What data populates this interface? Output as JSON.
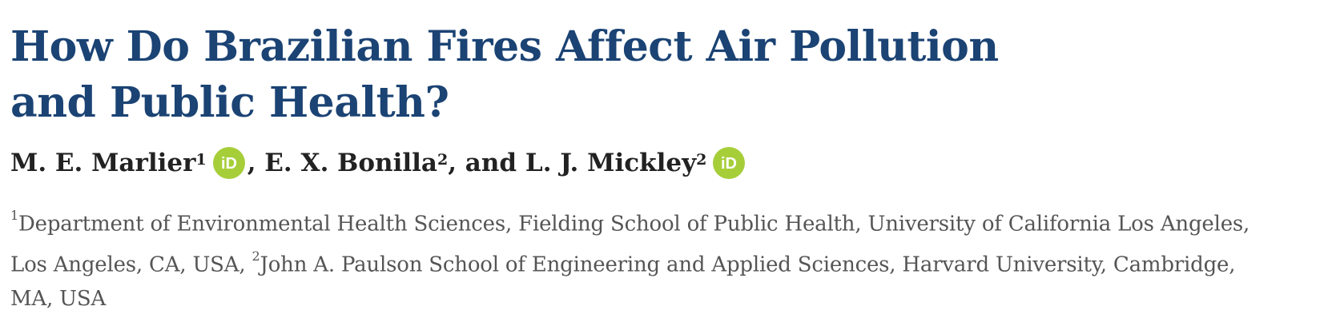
{
  "title": "How Do Brazilian Fires Affect Air Pollution\nand Public Health?",
  "authors": [
    {
      "name": "M. E. Marlier",
      "affil": "1",
      "orcid": true,
      "sep": ", "
    },
    {
      "name": "E. X. Bonilla",
      "affil": "2",
      "orcid": false,
      "sep": ", and "
    },
    {
      "name": "L. J. Mickley",
      "affil": "2",
      "orcid": true,
      "sep": ""
    }
  ],
  "orcid_label": "iD",
  "orcid_color": "#a6ce39",
  "affiliations": {
    "line1_sup": "1",
    "line1_text": "Department of Environmental Health Sciences, Fielding School of Public Health, University of California Los Angeles,",
    "line2_pre": "Los Angeles, CA, USA, ",
    "line2_sup": "2",
    "line2_text": "John A. Paulson School of Engineering and Applied Sciences, Harvard University, Cambridge,",
    "line3_text": "MA, USA"
  },
  "colors": {
    "title": "#1b4374",
    "authors": "#222222",
    "affiliations": "#555555"
  }
}
